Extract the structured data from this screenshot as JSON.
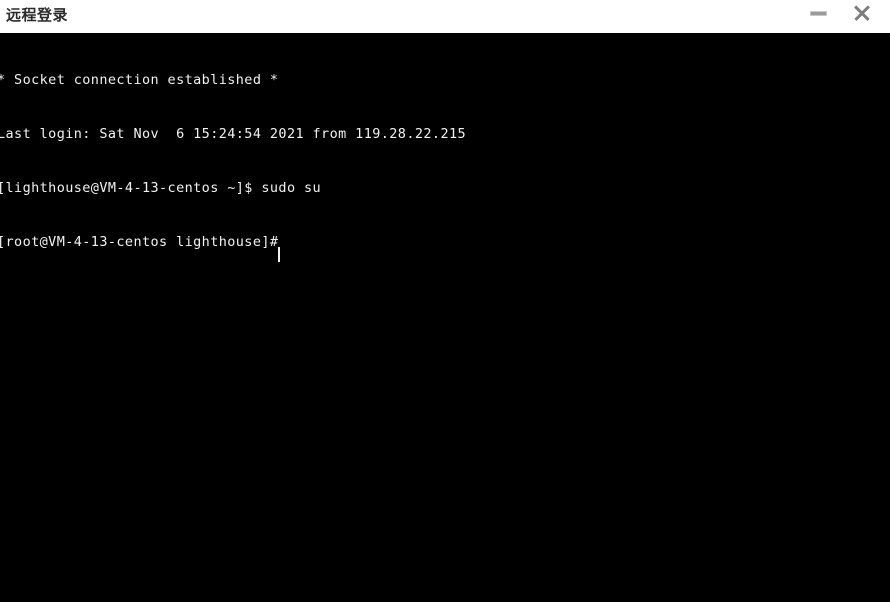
{
  "window": {
    "title": "远程登录",
    "background_color": "#000000",
    "titlebar_color": "#ffffff",
    "controls": {
      "minimize": {
        "icon": "minimize-icon",
        "label": "—"
      },
      "close": {
        "icon": "close-icon",
        "label": "✕"
      }
    }
  },
  "terminal": {
    "foreground_color": "#f2f2f2",
    "background_color": "#000000",
    "lines": [
      "* Socket connection established *",
      "Last login: Sat Nov  6 15:24:54 2021 from 119.28.22.215",
      "[lighthouse@VM-4-13-centos ~]$ sudo su",
      "[root@VM-4-13-centos lighthouse]#"
    ],
    "prompt_user": "lighthouse",
    "prompt_root": "root",
    "hostname": "VM-4-13-centos",
    "command_entered": "sudo su",
    "login_ip": "119.28.22.215",
    "login_time": "Sat Nov  6 15:24:54 2021",
    "cursor_char": "#"
  }
}
